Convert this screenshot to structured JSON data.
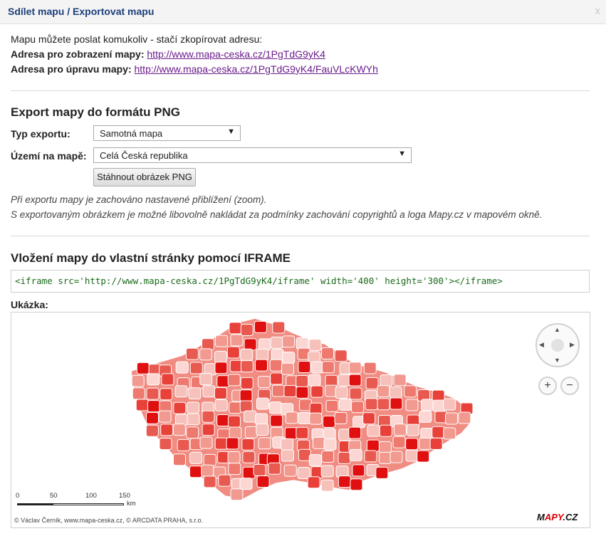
{
  "dialog": {
    "title": "Sdílet mapu / Exportovat mapu",
    "close": "x"
  },
  "share": {
    "intro": "Mapu můžete poslat komukoliv - stačí zkopírovat adresu:",
    "view_label": "Adresa pro zobrazení mapy:",
    "view_url": "http://www.mapa-ceska.cz/1PgTdG9yK4",
    "edit_label": "Adresa pro úpravu mapy:",
    "edit_url": "http://www.mapa-ceska.cz/1PgTdG9yK4/FauVLcKWYh"
  },
  "export": {
    "heading": "Export mapy do formátu PNG",
    "type_label": "Typ exportu:",
    "type_value": "Samotná mapa",
    "area_label": "Území na mapě:",
    "area_value": "Celá Česká republika",
    "download_button": "Stáhnout obrázek PNG",
    "note1": "Při exportu mapy je zachováno nastavené přiblížení (zoom).",
    "note2": "S exportovaným obrázkem je možné libovolně nakládat za podmínky zachování copyrightů a loga Mapy.cz v mapovém okně."
  },
  "iframe": {
    "heading": "Vložení mapy do vlastní stránky pomocí IFRAME",
    "code": "<iframe src='http://www.mapa-ceska.cz/1PgTdG9yK4/iframe' width='400' height='300'></iframe>",
    "preview_label": "Ukázka:"
  },
  "map": {
    "scale_labels": [
      "0",
      "50",
      "100",
      "150"
    ],
    "scale_unit": "km",
    "copyright": "© Václav Černík, www.mapa-ceska.cz, © ARCDATA PRAHA, s.r.o.",
    "logo_brand": "Mapy.cz",
    "fill_color": "#e8413a",
    "dark_color": "#e01010"
  }
}
